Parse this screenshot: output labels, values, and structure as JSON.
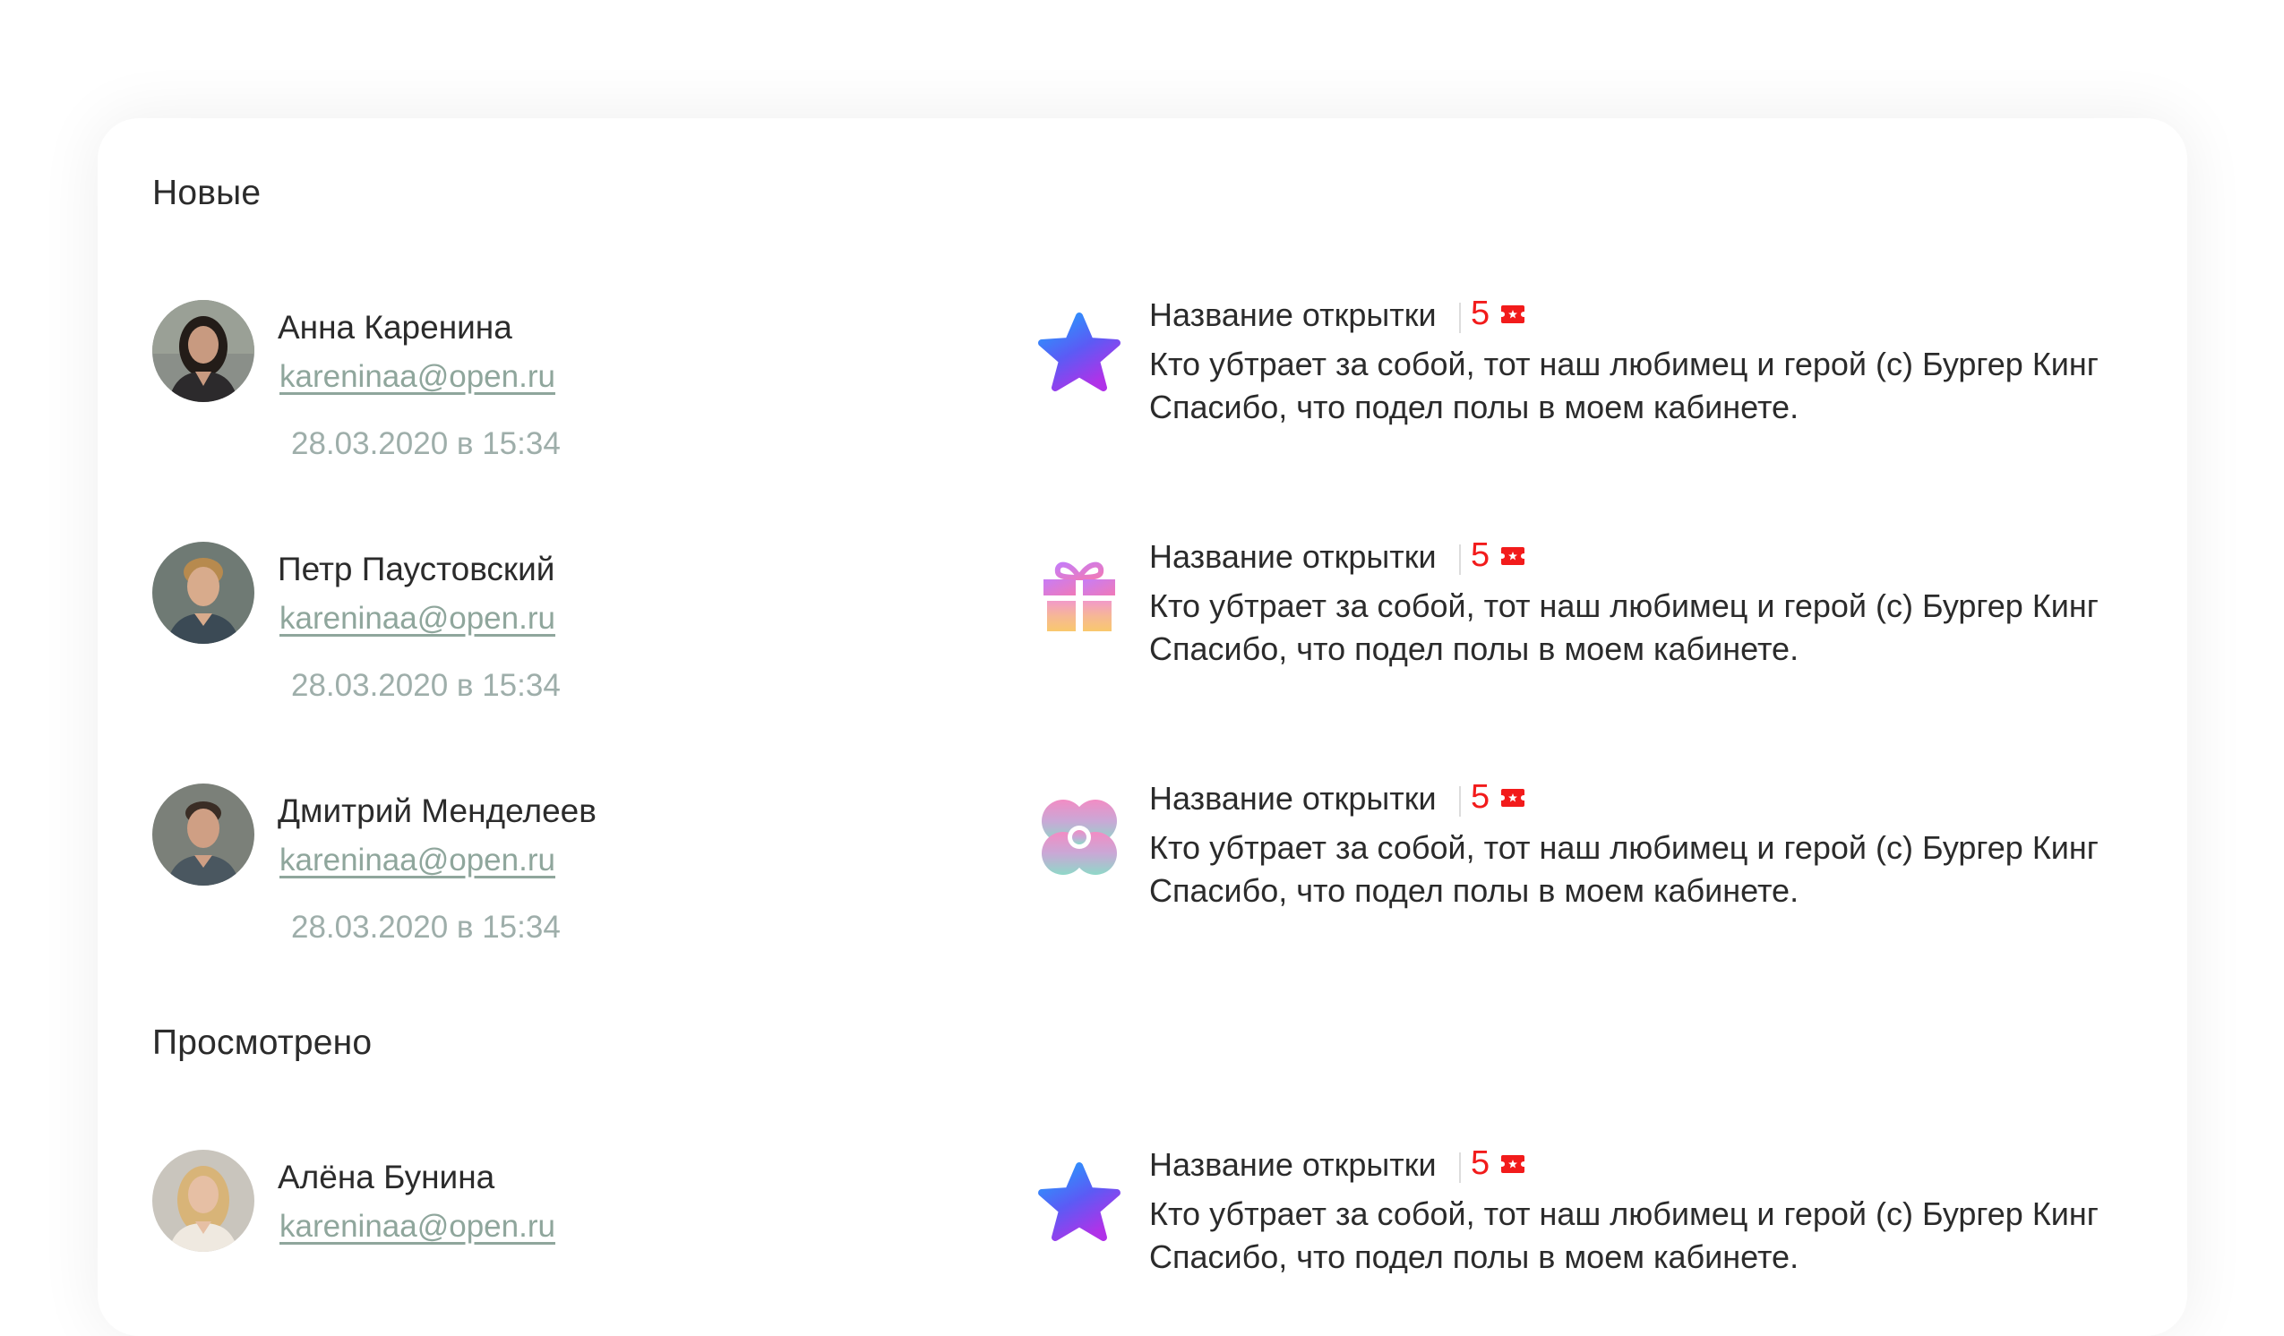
{
  "sections": [
    {
      "title": "Новые",
      "items": [
        {
          "name": "Анна Каренина",
          "email": "kareninaa@open.ru",
          "date": "28.03.2020 в 15:34",
          "postcard_title": "Название открытки",
          "points": "5",
          "icon": "star-icon",
          "message_line1": "Кто убтрает за собой, тот наш любимец и герой (с) Бургер Кинг",
          "message_line2": "Спасибо, что подел полы в моем кабинете."
        },
        {
          "name": "Петр Паустовский",
          "email": "kareninaa@open.ru",
          "date": "28.03.2020 в 15:34",
          "postcard_title": "Название открытки",
          "points": "5",
          "icon": "gift-icon",
          "message_line1": "Кто убтрает за собой, тот наш любимец и герой (с) Бургер Кинг",
          "message_line2": "Спасибо, что подел полы в моем кабинете."
        },
        {
          "name": "Дмитрий Менделеев",
          "email": "kareninaa@open.ru",
          "date": "28.03.2020 в 15:34",
          "postcard_title": "Название открытки",
          "points": "5",
          "icon": "flower-icon",
          "message_line1": "Кто убтрает за собой, тот наш любимец и герой (с) Бургер Кинг",
          "message_line2": "Спасибо, что подел полы в моем кабинете."
        }
      ]
    },
    {
      "title": "Просмотрено",
      "items": [
        {
          "name": "Алёна Бунина",
          "email": "kareninaa@open.ru",
          "postcard_title": "Название открытки",
          "points": "5",
          "icon": "star-icon",
          "message_line1": "Кто убтрает за собой, тот наш любимец и герой (с) Бургер Кинг",
          "message_line2": "Спасибо, что подел полы в моем кабинете."
        }
      ]
    }
  ],
  "colors": {
    "accent_red": "#f21b1b",
    "email": "#8fa69c",
    "date": "#9eaeaa",
    "text": "#2b2b2b"
  }
}
